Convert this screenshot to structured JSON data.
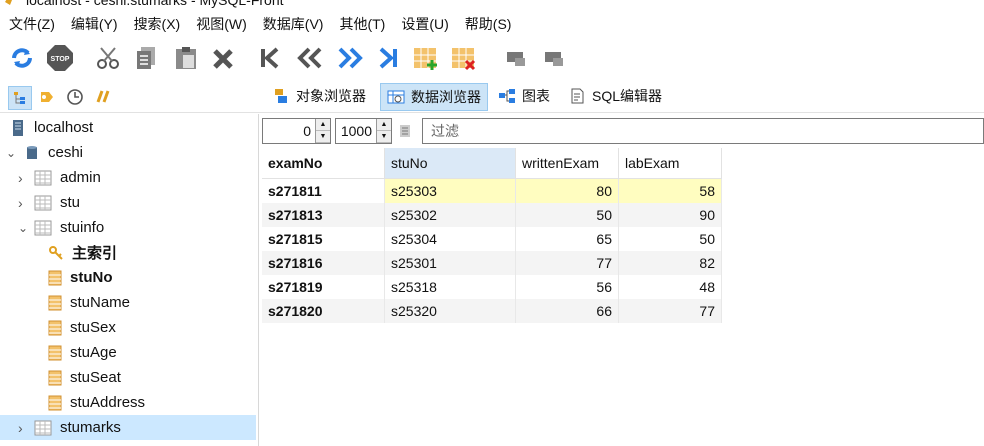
{
  "window": {
    "title": "localhost - ceshi.stumarks - MySQL-Front"
  },
  "menu": [
    "文件(Z)",
    "编辑(Y)",
    "搜索(X)",
    "视图(W)",
    "数据库(V)",
    "其他(T)",
    "设置(U)",
    "帮助(S)"
  ],
  "toolbar": {
    "buttons": [
      "refresh-icon",
      "stop-icon",
      "cut-icon",
      "copy-icon",
      "paste-icon",
      "delete-icon",
      "first-record-icon",
      "previous-icon",
      "next-icon",
      "last-record-icon",
      "insert-record-icon",
      "delete-record-icon",
      "post-icon",
      "cancel-icon"
    ]
  },
  "tabs": [
    {
      "label": "对象浏览器",
      "icon": "object-browser-icon"
    },
    {
      "label": "数据浏览器",
      "icon": "data-browser-icon"
    },
    {
      "label": "图表",
      "icon": "diagram-icon"
    },
    {
      "label": "SQL编辑器",
      "icon": "sql-editor-icon"
    }
  ],
  "tree": {
    "server": "localhost",
    "database": "ceshi",
    "tables": [
      "admin",
      "stu",
      "stuinfo"
    ],
    "stuinfo_children": [
      "主索引",
      "stuNo",
      "stuName",
      "stuSex",
      "stuAge",
      "stuSeat",
      "stuAddress"
    ],
    "selected": "stumarks"
  },
  "pager": {
    "offset": "0",
    "limit": "1000",
    "filter_placeholder": "过滤"
  },
  "grid": {
    "columns": [
      "examNo",
      "stuNo",
      "writtenExam",
      "labExam"
    ],
    "rows": [
      [
        "s271811",
        "s25303",
        "80",
        "58"
      ],
      [
        "s271813",
        "s25302",
        "50",
        "90"
      ],
      [
        "s271815",
        "s25304",
        "65",
        "50"
      ],
      [
        "s271816",
        "s25301",
        "77",
        "82"
      ],
      [
        "s271819",
        "s25318",
        "56",
        "48"
      ],
      [
        "s271820",
        "s25320",
        "66",
        "77"
      ]
    ]
  },
  "colors": {
    "accent": "#cce4f7",
    "selection": "#cce8ff",
    "current_row": "#fffdc0"
  }
}
